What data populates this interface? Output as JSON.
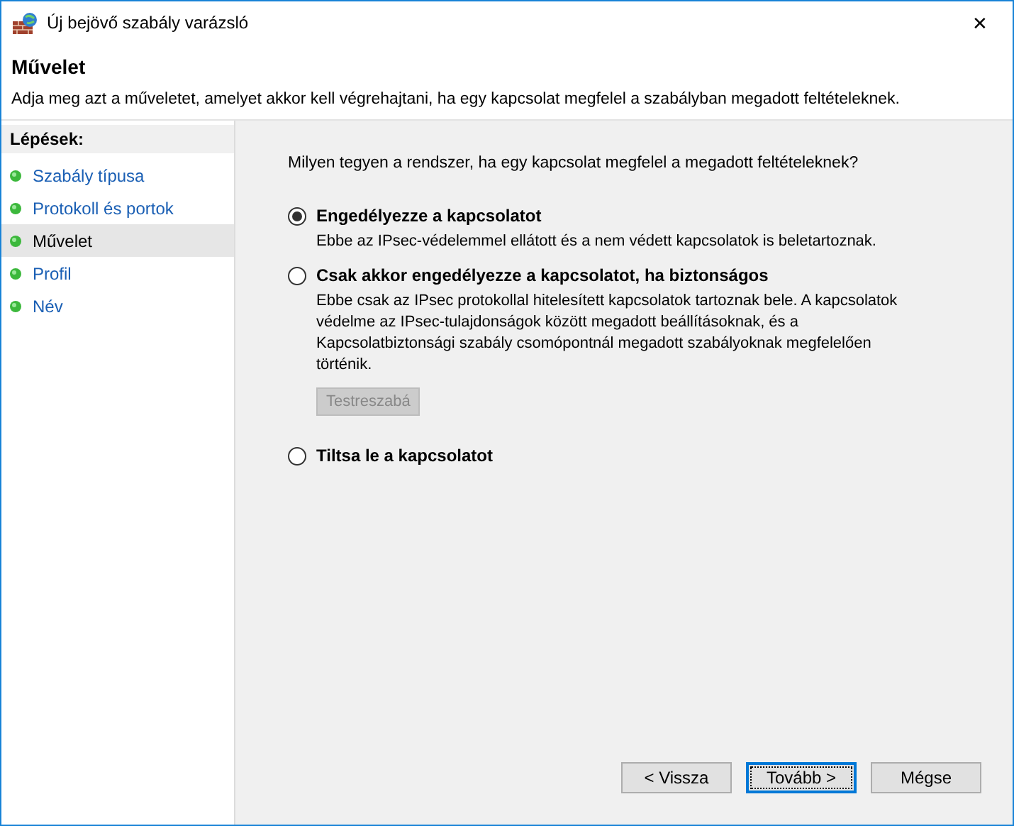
{
  "window": {
    "title": "Új bejövő szabály varázsló",
    "close": "✕"
  },
  "header": {
    "title": "Művelet",
    "description": "Adja meg azt a műveletet, amelyet akkor kell végrehajtani, ha egy kapcsolat megfelel a szabályban megadott feltételeknek."
  },
  "steps": {
    "title": "Lépések:",
    "items": [
      {
        "label": "Szabály típusa",
        "selected": false
      },
      {
        "label": "Protokoll és portok",
        "selected": false
      },
      {
        "label": "Művelet",
        "selected": true
      },
      {
        "label": "Profil",
        "selected": false
      },
      {
        "label": "Név",
        "selected": false
      }
    ]
  },
  "question": "Milyen tegyen a rendszer, ha egy kapcsolat megfelel a megadott feltételeknek?",
  "options": [
    {
      "label": "Engedélyezze a kapcsolatot",
      "selected": true,
      "description": "Ebbe az IPsec-védelemmel ellátott és a nem védett kapcsolatok is beletartoznak."
    },
    {
      "label": "Csak akkor engedélyezze a kapcsolatot, ha biztonságos",
      "selected": false,
      "description": "Ebbe csak az IPsec protokollal hitelesített kapcsolatok tartoznak bele. A kapcsolatok védelme az IPsec-tulajdonságok között megadott beállításoknak, és a Kapcsolatbiztonsági szabály csomópontnál megadott szabályoknak megfelelően történik.",
      "button": {
        "label": "Testreszabá",
        "disabled": true
      }
    },
    {
      "label": "Tiltsa le a kapcsolatot",
      "selected": false
    }
  ],
  "buttons": [
    {
      "label": "< Vissza",
      "focused": false
    },
    {
      "label": "Tovább >",
      "focused": true
    },
    {
      "label": "Mégse",
      "focused": false
    }
  ]
}
